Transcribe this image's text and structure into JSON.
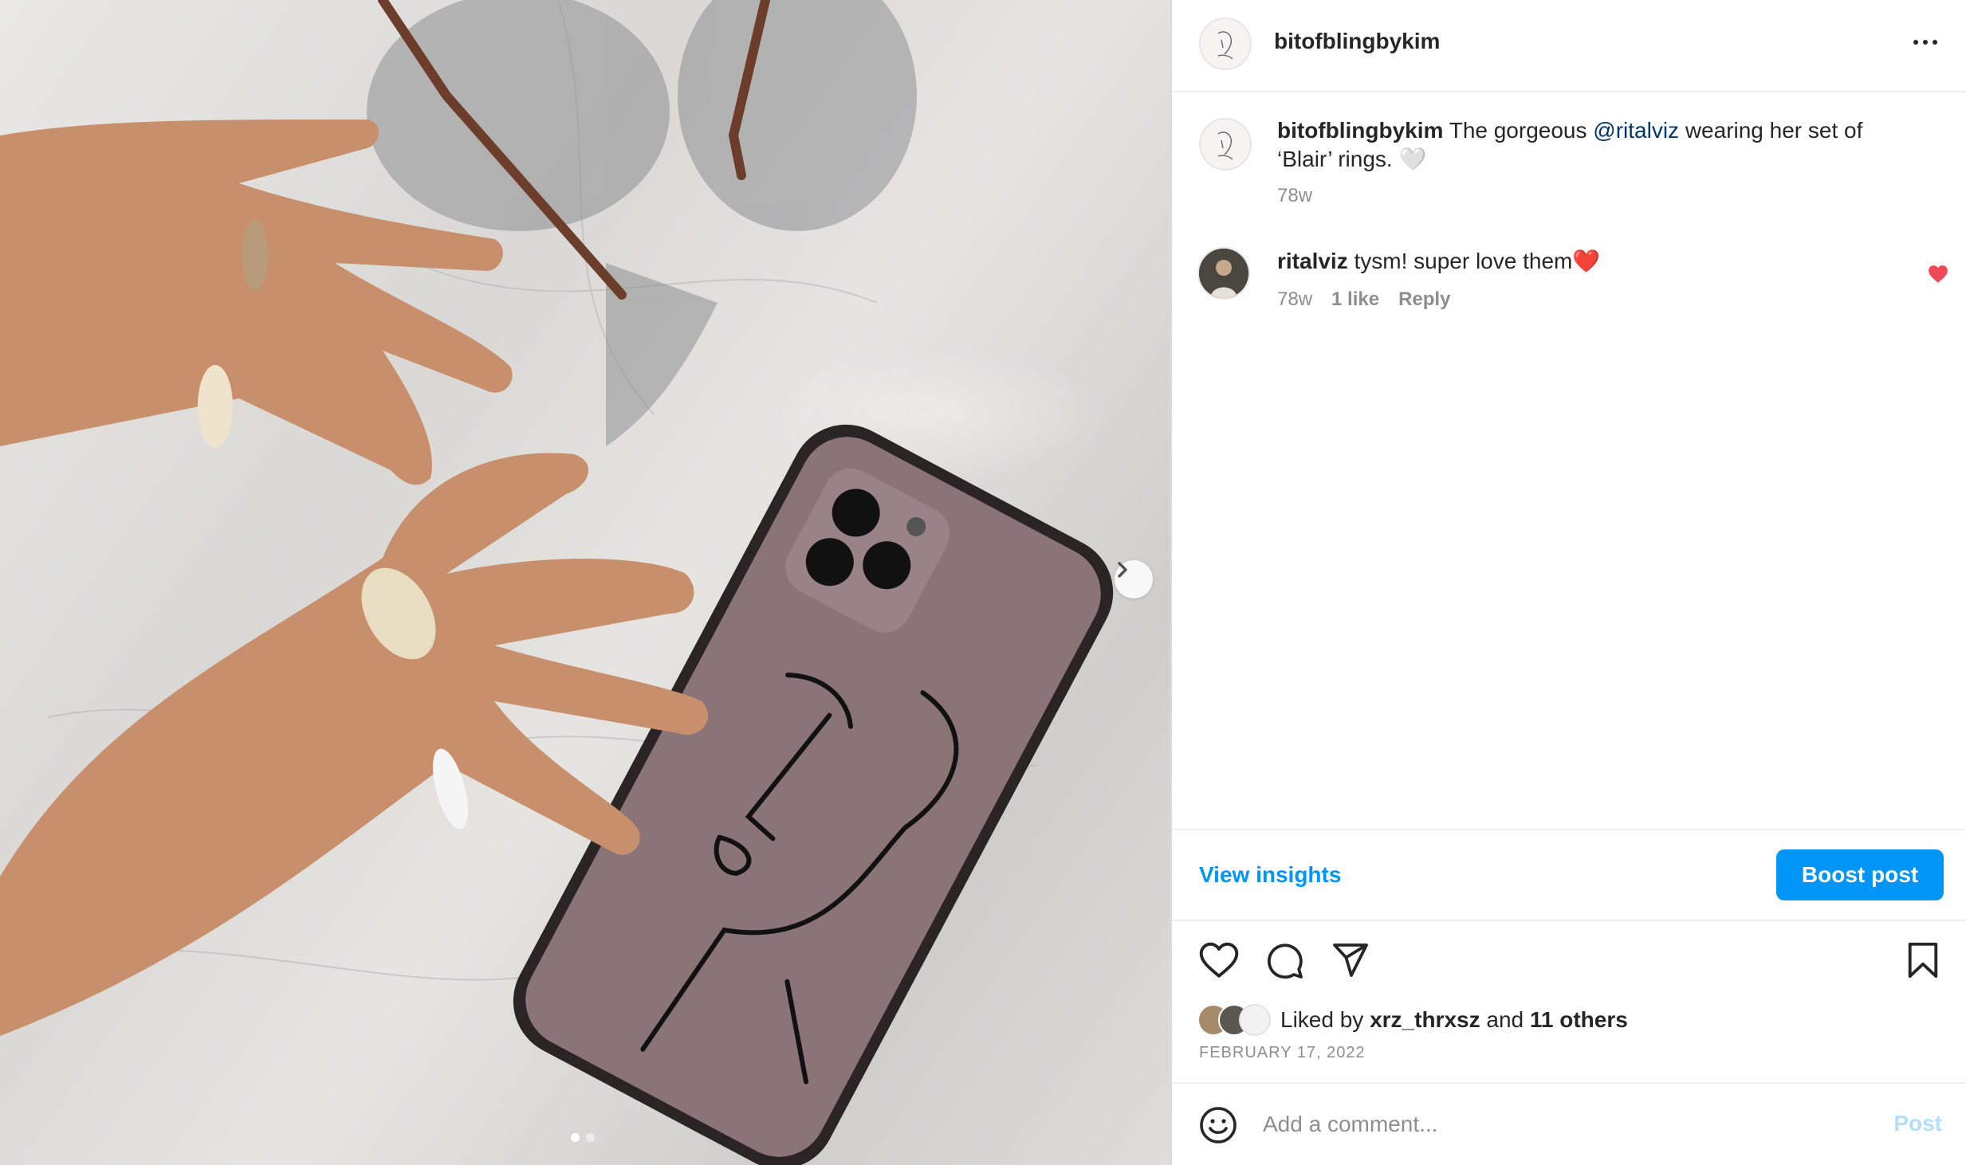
{
  "post": {
    "username": "bitofblingbykim",
    "more_icon": "more-icon",
    "photo": {
      "description_icon": "post-photo",
      "slides": 2,
      "active_slide": 1
    }
  },
  "caption": {
    "username": "bitofblingbykim",
    "text_before": " The gorgeous ",
    "mention": "@ritalviz",
    "text_after": " wearing her set of ‘Blair’ rings. 🤍",
    "time": "78w"
  },
  "comment": {
    "username": "ritalviz",
    "text": " tysm! super love them❤️",
    "time": "78w",
    "likes": "1 like",
    "reply": "Reply",
    "liked": true
  },
  "insights": {
    "label": "View insights"
  },
  "boost": {
    "label": "Boost post"
  },
  "likes": {
    "prefix": "Liked by ",
    "user": "xrz_thrxsz",
    "middle": " and ",
    "others": "11 others"
  },
  "date": "FEBRUARY 17, 2022",
  "add_comment": {
    "placeholder": "Add a comment...",
    "post_label": "Post"
  },
  "colors": {
    "accent": "#0095f6",
    "heart": "#ed4956",
    "muted": "#8e8e8e"
  }
}
